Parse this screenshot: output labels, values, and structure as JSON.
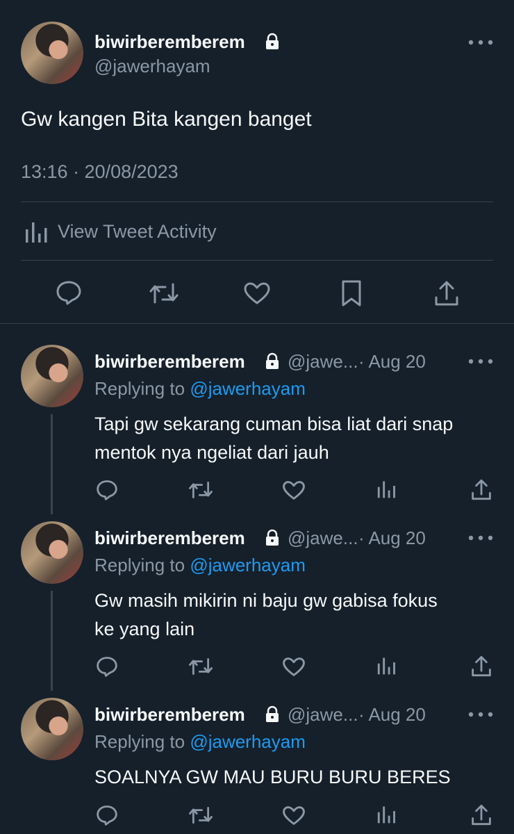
{
  "main_tweet": {
    "display_name": "biwirberemberem",
    "handle": "@jawerhayam",
    "text": "Gw kangen Bita kangen banget",
    "timestamp": "13:16 · 20/08/2023",
    "activity_label": "View Tweet Activity"
  },
  "replies": [
    {
      "display_name": "biwirberemberem",
      "handle": "@jawe...",
      "date": "· Aug 20",
      "replying_prefix": "Replying to",
      "replying_to": "@jawerhayam",
      "text_lines": [
        "Tapi gw sekarang cuman bisa liat dari snap",
        "mentok nya ngeliat dari jauh"
      ]
    },
    {
      "display_name": "biwirberemberem",
      "handle": "@jawe...",
      "date": "· Aug 20",
      "replying_prefix": "Replying to",
      "replying_to": "@jawerhayam",
      "text_lines": [
        "Gw masih mikirin ni baju gw gabisa fokus",
        "ke yang lain"
      ]
    },
    {
      "display_name": "biwirberemberem",
      "handle": "@jawe...",
      "date": "· Aug 20",
      "replying_prefix": "Replying to",
      "replying_to": "@jawerhayam",
      "text_lines": [
        "SOALNYA GW MAU BURU BURU BERES"
      ]
    }
  ],
  "icons": {
    "more": "more-icon",
    "lock": "lock-icon",
    "reply": "reply-icon",
    "retweet": "retweet-icon",
    "like": "like-icon",
    "bookmark": "bookmark-icon",
    "share": "share-icon",
    "analytics": "analytics-icon"
  },
  "colors": {
    "background": "#15202b",
    "text": "#f7f9f9",
    "muted": "#8b98a5",
    "accent": "#1d9bf0",
    "divider": "#38444d"
  }
}
